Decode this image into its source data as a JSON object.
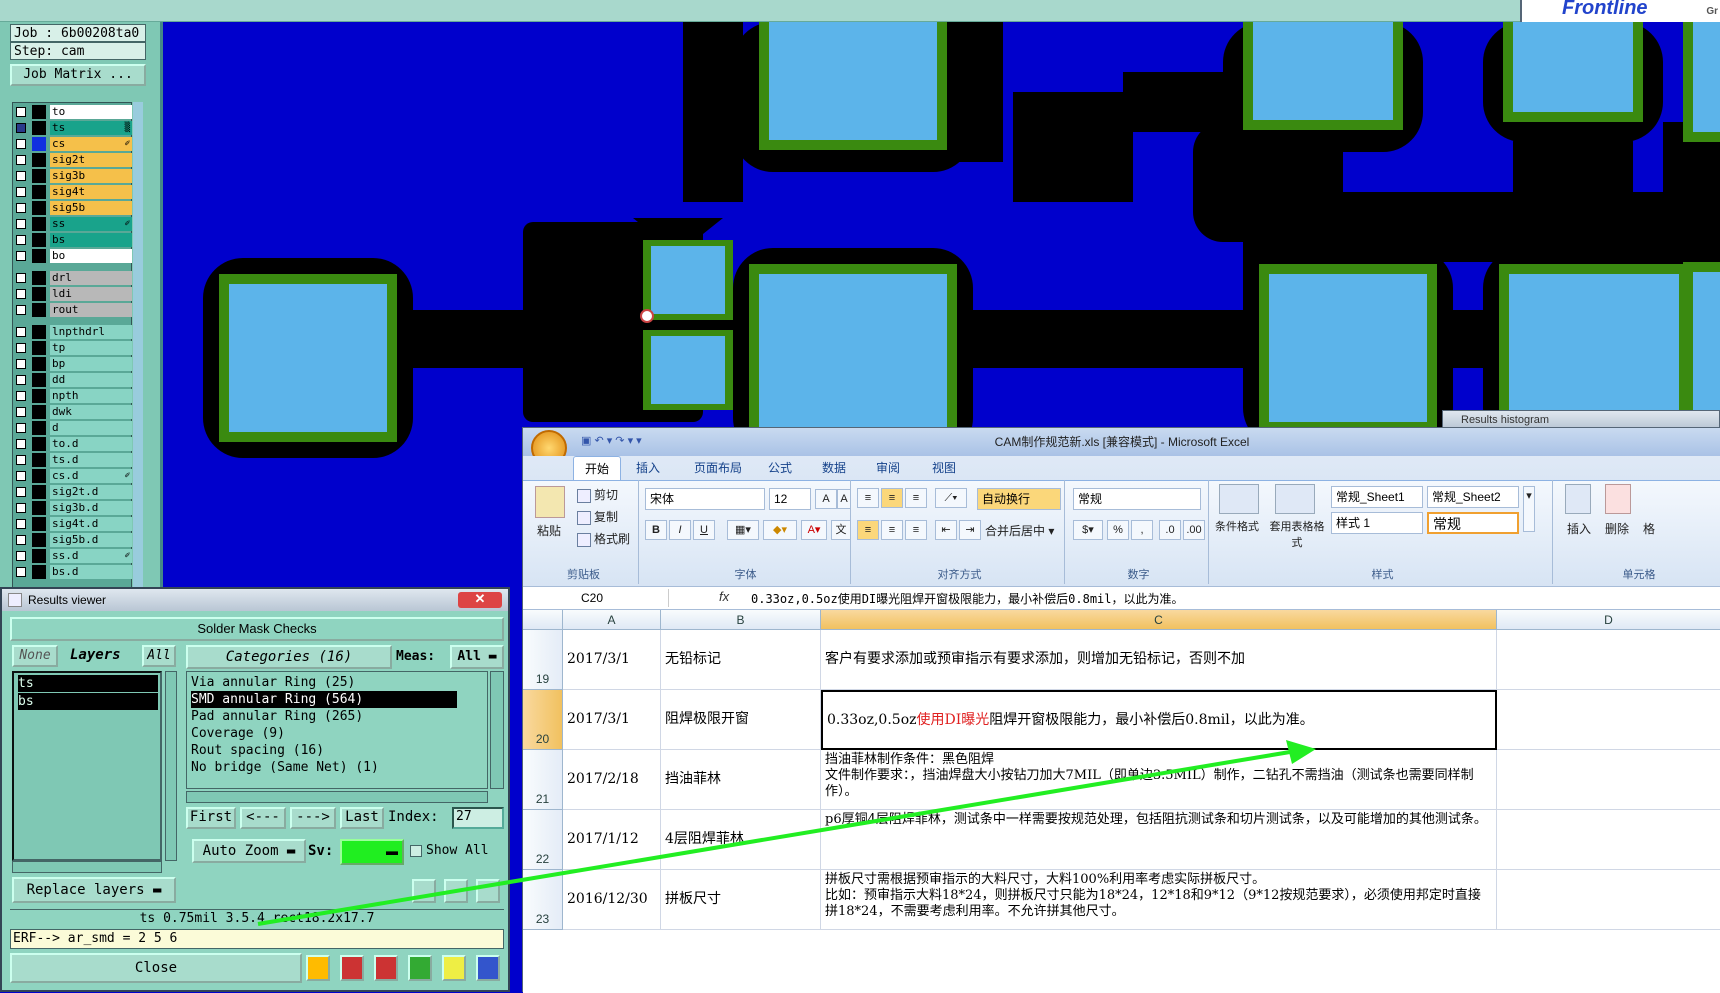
{
  "app": {
    "brand": "Frontline",
    "brand_sub": "Gr"
  },
  "job": {
    "job_line": "Job :  6b00208ta0",
    "step_line": "Step:  cam",
    "matrix_button": "Job Matrix ..."
  },
  "layers": [
    {
      "name": "to",
      "color": "#ffffff",
      "swatch": "#000000",
      "checked": false,
      "mark": ""
    },
    {
      "name": "ts",
      "color": "#19a38b",
      "swatch": "#000000",
      "checked": true,
      "mark": "▒"
    },
    {
      "name": "cs",
      "color": "#f5c04a",
      "swatch": "#1030e0",
      "checked": false,
      "mark": "✐"
    },
    {
      "name": "sig2t",
      "color": "#f5c04a",
      "swatch": "#000000",
      "checked": false,
      "mark": ""
    },
    {
      "name": "sig3b",
      "color": "#f5c04a",
      "swatch": "#000000",
      "checked": false,
      "mark": ""
    },
    {
      "name": "sig4t",
      "color": "#f5c04a",
      "swatch": "#000000",
      "checked": false,
      "mark": ""
    },
    {
      "name": "sig5b",
      "color": "#f5c04a",
      "swatch": "#000000",
      "checked": false,
      "mark": ""
    },
    {
      "name": "ss",
      "color": "#19a38b",
      "swatch": "#000000",
      "checked": false,
      "mark": "✐"
    },
    {
      "name": "bs",
      "color": "#19a38b",
      "swatch": "#000000",
      "checked": false,
      "mark": ""
    },
    {
      "name": "bo",
      "color": "#ffffff",
      "swatch": "#000000",
      "checked": false,
      "mark": ""
    },
    {
      "name": "drl",
      "color": "#b8b8b8",
      "swatch": "#000000",
      "checked": false,
      "mark": ""
    },
    {
      "name": "ldi",
      "color": "#b8b8b8",
      "swatch": "#000000",
      "checked": false,
      "mark": ""
    },
    {
      "name": "rout",
      "color": "#b8b8b8",
      "swatch": "#000000",
      "checked": false,
      "mark": ""
    },
    {
      "name": "lnpthdrl",
      "color": "#88d4c4",
      "swatch": "#000000",
      "checked": false,
      "mark": ""
    },
    {
      "name": "tp",
      "color": "#88d4c4",
      "swatch": "#000000",
      "checked": false,
      "mark": ""
    },
    {
      "name": "bp",
      "color": "#88d4c4",
      "swatch": "#000000",
      "checked": false,
      "mark": ""
    },
    {
      "name": "dd",
      "color": "#88d4c4",
      "swatch": "#000000",
      "checked": false,
      "mark": ""
    },
    {
      "name": "npth",
      "color": "#88d4c4",
      "swatch": "#000000",
      "checked": false,
      "mark": ""
    },
    {
      "name": "dwk",
      "color": "#88d4c4",
      "swatch": "#000000",
      "checked": false,
      "mark": ""
    },
    {
      "name": "d",
      "color": "#88d4c4",
      "swatch": "#000000",
      "checked": false,
      "mark": ""
    },
    {
      "name": "to.d",
      "color": "#88d4c4",
      "swatch": "#000000",
      "checked": false,
      "mark": ""
    },
    {
      "name": "ts.d",
      "color": "#88d4c4",
      "swatch": "#000000",
      "checked": false,
      "mark": ""
    },
    {
      "name": "cs.d",
      "color": "#88d4c4",
      "swatch": "#000000",
      "checked": false,
      "mark": "✐"
    },
    {
      "name": "sig2t.d",
      "color": "#88d4c4",
      "swatch": "#000000",
      "checked": false,
      "mark": ""
    },
    {
      "name": "sig3b.d",
      "color": "#88d4c4",
      "swatch": "#000000",
      "checked": false,
      "mark": ""
    },
    {
      "name": "sig4t.d",
      "color": "#88d4c4",
      "swatch": "#000000",
      "checked": false,
      "mark": ""
    },
    {
      "name": "sig5b.d",
      "color": "#88d4c4",
      "swatch": "#000000",
      "checked": false,
      "mark": ""
    },
    {
      "name": "ss.d",
      "color": "#88d4c4",
      "swatch": "#000000",
      "checked": false,
      "mark": "✐"
    },
    {
      "name": "bs.d",
      "color": "#88d4c4",
      "swatch": "#000000",
      "checked": false,
      "mark": ""
    }
  ],
  "results_viewer": {
    "title": "Results viewer",
    "close_x": "✕",
    "header": "Solder Mask Checks",
    "none_btn": "None",
    "layers_label": "Layers",
    "all_btn": "All",
    "categories_label": "Categories (16)",
    "meas_label": "Meas:",
    "meas_value": "All",
    "layer_items": [
      "ts",
      "bs"
    ],
    "categories": [
      {
        "label": "Via annular Ring (25)",
        "selected": false
      },
      {
        "label": "SMD annular Ring (564)",
        "selected": true
      },
      {
        "label": "Pad annular Ring (265)",
        "selected": false
      },
      {
        "label": "Coverage (9)",
        "selected": false
      },
      {
        "label": "Rout spacing (16)",
        "selected": false
      },
      {
        "label": "No bridge (Same Net) (1)",
        "selected": false
      }
    ],
    "first_btn": "First",
    "prev_btn": "<---",
    "next_btn": "--->",
    "last_btn": "Last",
    "index_label": "Index:",
    "index_value": "27",
    "auto_zoom": "Auto Zoom",
    "sv_label": "Sv:",
    "show_all": "Show All",
    "replace_layers": "Replace layers",
    "status_line": "ts 0.75mil  3.5.4  rect18.2x17.7",
    "erf_line": "ERF--> ar_smd = 2 5 6",
    "close_btn": "Close"
  },
  "excel": {
    "title": "CAM制作规范新.xls  [兼容模式] - Microsoft Excel",
    "tabs": [
      "开始",
      "插入",
      "页面布局",
      "公式",
      "数据",
      "审阅",
      "视图"
    ],
    "clipboard": {
      "paste": "粘贴",
      "cut": "剪切",
      "copy": "复制",
      "format_painter": "格式刷",
      "group": "剪贴板"
    },
    "font": {
      "name": "宋体",
      "size": "12",
      "group": "字体"
    },
    "align": {
      "wrap": "自动换行",
      "merge": "合并后居中",
      "group": "对齐方式"
    },
    "number": {
      "format": "常规",
      "group": "数字"
    },
    "styles": {
      "cond_format": "条件格式",
      "table_format": "套用表格格式",
      "s1": "常规_Sheet1",
      "s2": "常规_Sheet2",
      "s3": "样式 1",
      "s4": "常规",
      "group": "样式"
    },
    "cells_group": {
      "insert": "插入",
      "delete": "删除",
      "format": "格",
      "group": "单元格"
    },
    "name_box": "C20",
    "fx": "fx",
    "formula": "0.33oz,0.5oz使用DI曝光阻焊开窗极限能力，最小补偿后0.8mil，以此为准。",
    "columns": [
      "A",
      "B",
      "C",
      "D"
    ],
    "rows": [
      {
        "num": "19",
        "a": "2017/3/1",
        "b": "无铅标记",
        "c": "客户有要求添加或预审指示有要求添加，则增加无铅标记，否则不加"
      },
      {
        "num": "20",
        "a": "2017/3/1",
        "b": "阻焊极限开窗",
        "c_pre": "0.33oz,0.5oz",
        "c_red": "使用DI曝光",
        "c_post": "阻焊开窗极限能力，最小补偿后0.8mil，以此为准。"
      },
      {
        "num": "21",
        "a": "2017/2/18",
        "b": "挡油菲林",
        "c": "挡油菲林制作条件：黑色阻焊\n文件制作要求：，挡油焊盘大小按钻刀加大7MIL（即单边3.5MIL）制作，二钻孔不需挡油（测试条也需要同样制作）。"
      },
      {
        "num": "22",
        "a": "2017/1/12",
        "b": "4层阻焊菲林",
        "c": "p6厚铜4层阻焊菲林，测试条中一样需要按规范处理，包括阻抗测试条和切片测试条，以及可能增加的其他测试条。"
      },
      {
        "num": "23",
        "a": "2016/12/30",
        "b": "拼板尺寸",
        "c": "拼板尺寸需根据预审指示的大料尺寸，大料100%利用率考虑实际拼板尺寸。\n比如：预审指示大料18*24，则拼板尺寸只能为18*24，12*18和9*12（9*12按规范要求），必须使用邦定时直接拼18*24，不需要考虑利用率。不允许拼其他尺寸。"
      }
    ]
  },
  "histogram_title": "Results histogram",
  "colors": {
    "board_bg": "#0000cc",
    "pad": "#5cb4ea",
    "ring": "#3a8a10",
    "black": "#000000",
    "arrow": "#22ee22",
    "excel_red": "#e02020"
  }
}
